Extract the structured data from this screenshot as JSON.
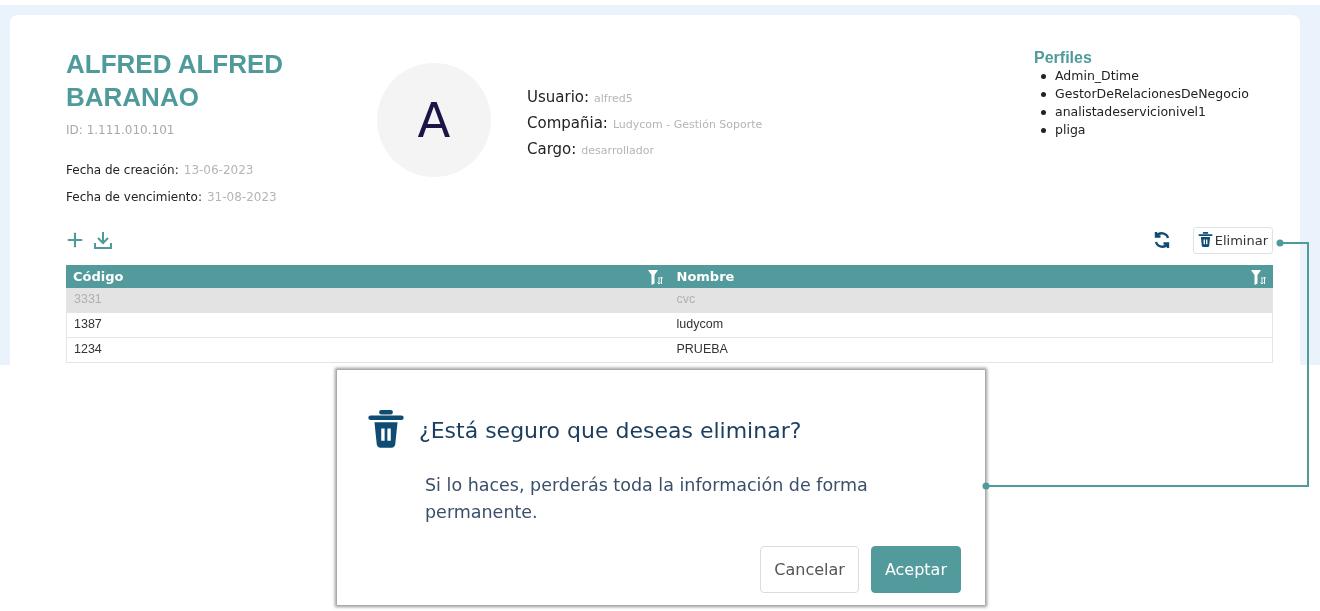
{
  "profile": {
    "name": "ALFRED ALFRED BARANAO",
    "id": "ID: 1.111.010.101",
    "dates": [
      {
        "label": "Fecha de creación:",
        "value": "13-06-2023"
      },
      {
        "label": "Fecha de vencimiento:",
        "value": "31-08-2023"
      }
    ],
    "avatar": "A",
    "details": [
      {
        "label": "Usuario:",
        "value": "alfred5"
      },
      {
        "label": "Compañia:",
        "value": "Ludycom - Gestión Soporte"
      },
      {
        "label": "Cargo:",
        "value": "desarrollador"
      }
    ]
  },
  "profiles": {
    "title": "Perfiles",
    "items": [
      "Admin_Dtime",
      "GestorDeRelacionesDeNegocio",
      "analistadeservicionivel1",
      "pliga"
    ]
  },
  "toolbar": {
    "delete_button": "Eliminar"
  },
  "table": {
    "columns": [
      "Código",
      "Nombre"
    ],
    "rows": [
      {
        "cells": [
          "3331",
          "cvc"
        ],
        "selected": true
      },
      {
        "cells": [
          "1387",
          "ludycom"
        ],
        "selected": false
      },
      {
        "cells": [
          "1234",
          "PRUEBA"
        ],
        "selected": false
      }
    ]
  },
  "dialog": {
    "title": "¿Está seguro que deseas eliminar?",
    "message": "Si lo haces, perderás toda la información de forma permanente.",
    "buttons": [
      {
        "label": "Cancelar",
        "kind": "secondary"
      },
      {
        "label": "Aceptar",
        "kind": "primary"
      }
    ]
  }
}
